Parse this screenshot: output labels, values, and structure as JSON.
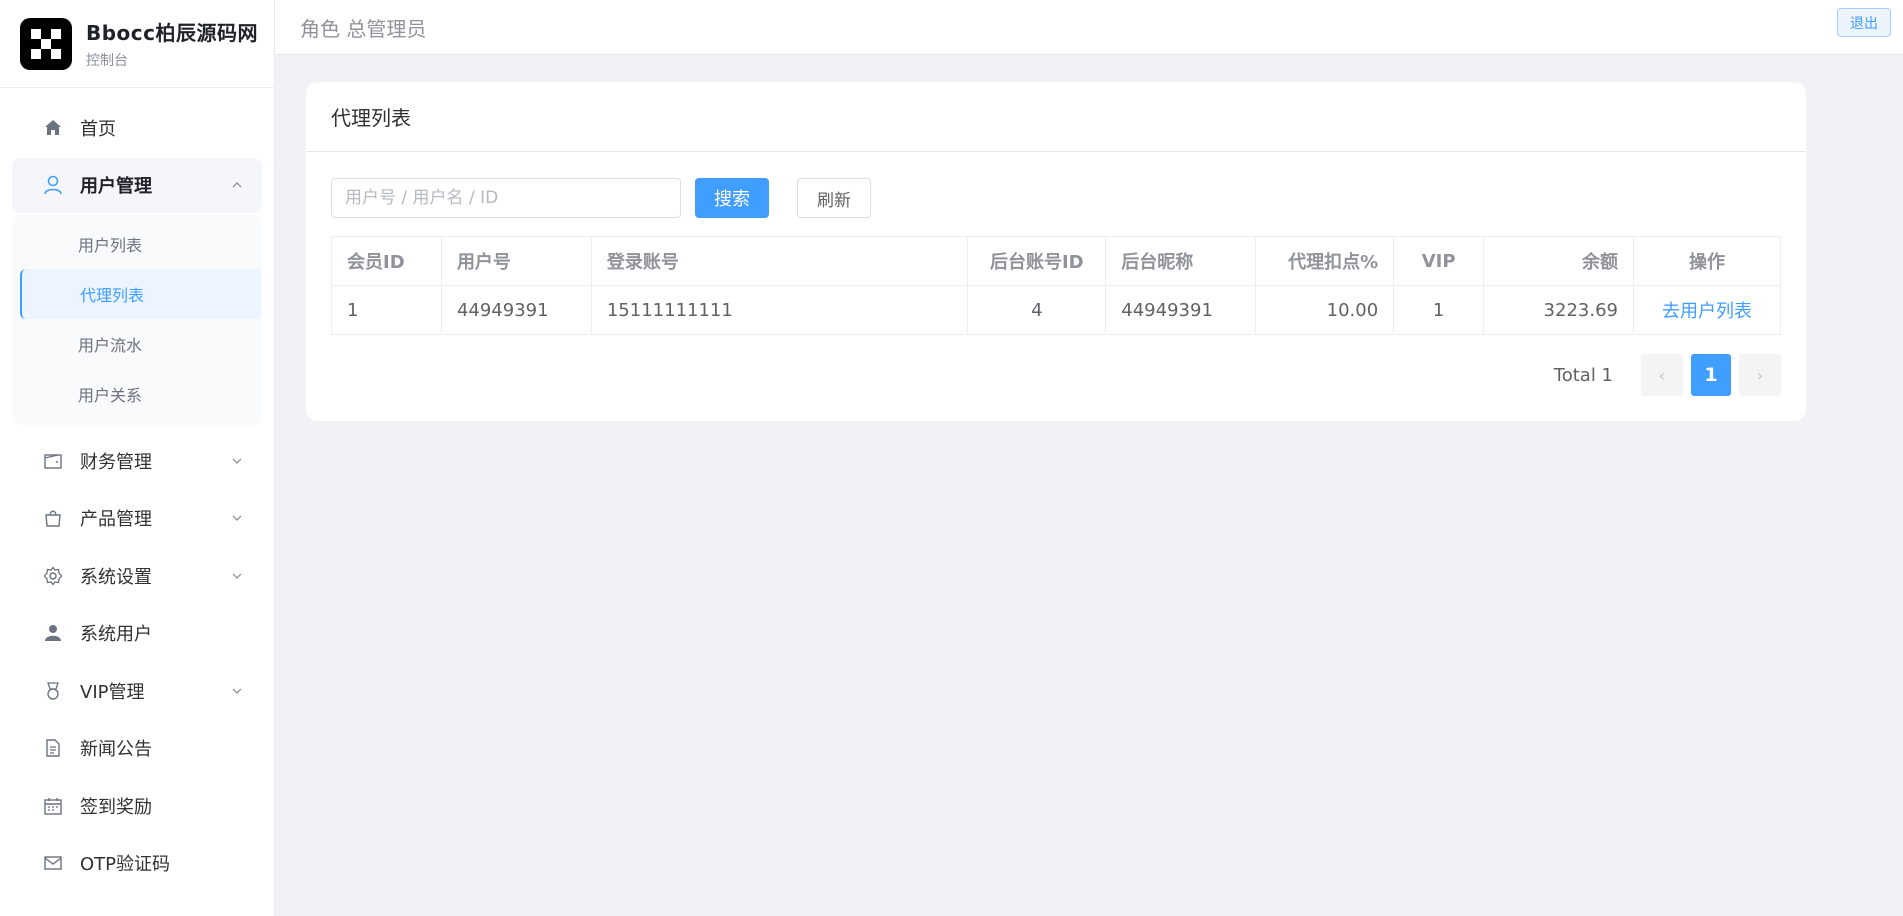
{
  "brand": {
    "name": "Bbocc柏辰源码网",
    "subtitle": "控制台"
  },
  "header": {
    "role_text": "角色 总管理员",
    "logout_label": "退出"
  },
  "sidebar": {
    "items": [
      {
        "label": "首页",
        "icon": "home-icon"
      },
      {
        "label": "用户管理",
        "icon": "user-outline-icon",
        "expanded": true
      },
      {
        "label": "财务管理",
        "icon": "wallet-icon"
      },
      {
        "label": "产品管理",
        "icon": "shopping-bag-icon"
      },
      {
        "label": "系统设置",
        "icon": "gear-icon"
      },
      {
        "label": "系统用户",
        "icon": "user-filled-icon"
      },
      {
        "label": "VIP管理",
        "icon": "medal-icon"
      },
      {
        "label": "新闻公告",
        "icon": "document-icon"
      },
      {
        "label": "签到奖励",
        "icon": "calendar-icon"
      },
      {
        "label": "OTP验证码",
        "icon": "mail-icon"
      }
    ],
    "submenu": [
      {
        "label": "用户列表"
      },
      {
        "label": "代理列表",
        "active": true
      },
      {
        "label": "用户流水"
      },
      {
        "label": "用户关系"
      }
    ]
  },
  "card": {
    "title": "代理列表",
    "search": {
      "placeholder": "用户号 / 用户名 / ID",
      "value": ""
    },
    "search_button": "搜索",
    "refresh_button": "刷新",
    "table": {
      "columns": [
        "会员ID",
        "用户号",
        "登录账号",
        "后台账号ID",
        "后台昵称",
        "代理扣点%",
        "VIP",
        "余额",
        "操作"
      ],
      "rows": [
        {
          "member_id": "1",
          "user_no": "44949391",
          "login": "15111111111",
          "admin_id": "4",
          "admin_nick": "44949391",
          "rebate": "10.00",
          "vip": "1",
          "balance": "3223.69",
          "action": "去用户列表"
        }
      ]
    },
    "pagination": {
      "total_text": "Total 1",
      "current_page": "1",
      "prev_symbol": "‹",
      "next_symbol": "›"
    }
  },
  "colors": {
    "primary": "#409eff",
    "background": "#f0f2f5",
    "sidebar_bg": "#ffffff"
  }
}
